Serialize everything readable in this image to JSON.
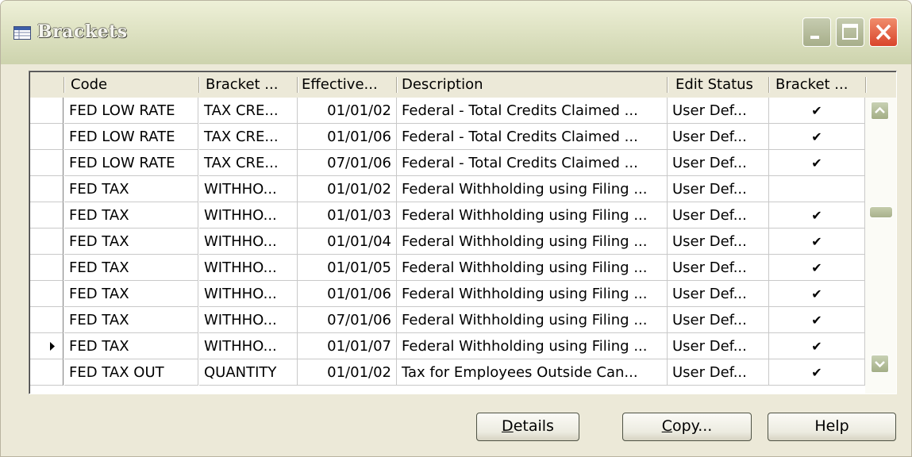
{
  "window": {
    "title": "Brackets",
    "icon": "table-window-icon"
  },
  "columns": [
    "Code",
    "Bracket ...",
    "Effective...",
    "Description",
    "Edit Status",
    "Bracket ..."
  ],
  "rows": [
    {
      "selector": "",
      "code": "FED LOW RATE",
      "bracket": "TAX CRE...",
      "effective": "01/01/02",
      "description": "Federal - Total Credits Claimed ...",
      "edit_status": "User Def...",
      "check": "✔"
    },
    {
      "selector": "",
      "code": "FED LOW RATE",
      "bracket": "TAX CRE...",
      "effective": "01/01/06",
      "description": "Federal - Total Credits Claimed ...",
      "edit_status": "User Def...",
      "check": "✔"
    },
    {
      "selector": "",
      "code": "FED LOW RATE",
      "bracket": "TAX CRE...",
      "effective": "07/01/06",
      "description": "Federal - Total Credits Claimed ...",
      "edit_status": "User Def...",
      "check": "✔"
    },
    {
      "selector": "",
      "code": "FED TAX",
      "bracket": "WITHHO...",
      "effective": "01/01/02",
      "description": "Federal Withholding using Filing ...",
      "edit_status": "User Def...",
      "check": ""
    },
    {
      "selector": "",
      "code": "FED TAX",
      "bracket": "WITHHO...",
      "effective": "01/01/03",
      "description": "Federal Withholding using Filing ...",
      "edit_status": "User Def...",
      "check": "✔"
    },
    {
      "selector": "",
      "code": "FED TAX",
      "bracket": "WITHHO...",
      "effective": "01/01/04",
      "description": "Federal Withholding using Filing ...",
      "edit_status": "User Def...",
      "check": "✔"
    },
    {
      "selector": "",
      "code": "FED TAX",
      "bracket": "WITHHO...",
      "effective": "01/01/05",
      "description": "Federal Withholding using Filing ...",
      "edit_status": "User Def...",
      "check": "✔"
    },
    {
      "selector": "",
      "code": "FED TAX",
      "bracket": "WITHHO...",
      "effective": "01/01/06",
      "description": "Federal Withholding using Filing ...",
      "edit_status": "User Def...",
      "check": "✔"
    },
    {
      "selector": "",
      "code": "FED TAX",
      "bracket": "WITHHO...",
      "effective": "07/01/06",
      "description": "Federal Withholding using Filing ...",
      "edit_status": "User Def...",
      "check": "✔"
    },
    {
      "selector": "▶",
      "code": "FED TAX",
      "bracket": "WITHHO...",
      "effective": "01/01/07",
      "description": "Federal Withholding using Filing ...",
      "edit_status": "User Def...",
      "check": "✔"
    },
    {
      "selector": "",
      "code": "FED TAX OUT",
      "bracket": "QUANTITY",
      "effective": "01/01/02",
      "description": "Tax for Employees Outside Can...",
      "edit_status": "User Def...",
      "check": "✔"
    }
  ],
  "buttons": {
    "details": {
      "label": "Details",
      "mnemonic": "D",
      "rest": "etails"
    },
    "copy": {
      "label": "Copy...",
      "mnemonic": "C",
      "rest": "opy..."
    },
    "help": {
      "label": "Help"
    }
  },
  "icons": [
    "minimize-icon",
    "maximize-icon",
    "close-icon",
    "scroll-up-icon",
    "scroll-down-icon",
    "row-pointer-icon",
    "checkmark-icon"
  ],
  "colors": {
    "window_bg": "#ece9d8",
    "close_button": "#d9452b",
    "titlebar": "#dfe3c4"
  }
}
